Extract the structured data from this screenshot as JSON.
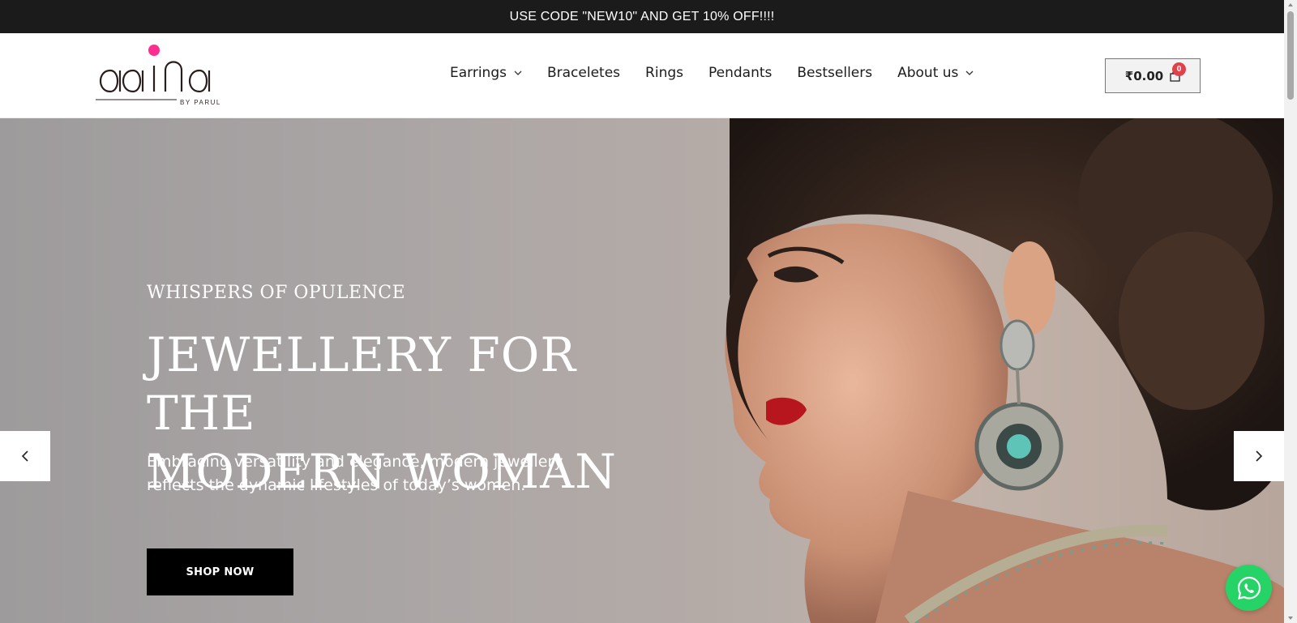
{
  "announcement": {
    "text": "USE CODE \"NEW10\" AND GET 10% OFF!!!!"
  },
  "logo": {
    "brand": "aaina",
    "sub": "BY PARUL",
    "dot_color": "#ff2d8f"
  },
  "nav": {
    "items": [
      {
        "label": "Earrings",
        "has_dropdown": true
      },
      {
        "label": "Braceletes",
        "has_dropdown": false
      },
      {
        "label": "Rings",
        "has_dropdown": false
      },
      {
        "label": "Pendants",
        "has_dropdown": false
      },
      {
        "label": "Bestsellers",
        "has_dropdown": false
      },
      {
        "label": "About us",
        "has_dropdown": true
      }
    ]
  },
  "cart": {
    "total": "₹0.00",
    "count": "0",
    "icon": "shopping-bag-icon"
  },
  "hero": {
    "eyebrow": "WHISPERS OF OPULENCE",
    "title_line1": "JEWELLERY FOR THE",
    "title_line2": "MODERN WOMAN",
    "description": "Embracing versatility and elegance, modern jewellery reflects the dynamic lifestyles of today’s women.",
    "cta": "SHOP NOW"
  },
  "carousel": {
    "prev_icon": "chevron-left-icon",
    "next_icon": "chevron-right-icon"
  },
  "whatsapp": {
    "icon": "whatsapp-icon",
    "color": "#25d366"
  },
  "colors": {
    "announcement_bg": "#1b1b1b",
    "cta_bg": "#000000",
    "badge": "#e0414b"
  }
}
